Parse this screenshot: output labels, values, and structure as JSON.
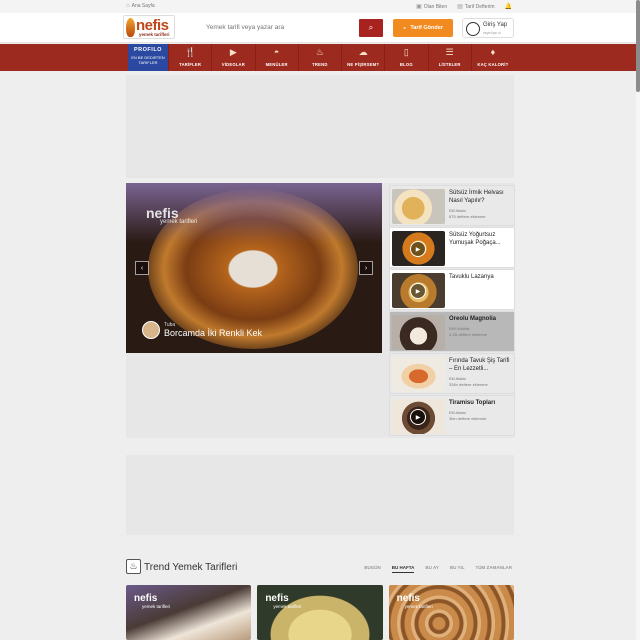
{
  "topbar": {
    "home": "Ana Sayfa",
    "olan_biten": "Olan Biten",
    "tarif_defterim": "Tarif Defterim"
  },
  "header": {
    "logo_word": "nefis",
    "logo_sub": "yemek tarifleri",
    "search_placeholder": "Yemek tarifi veya yazar ara",
    "send_recipe": "Tarif Gönder",
    "login_title": "Giriş Yap",
    "login_sub": "veya üye ol"
  },
  "nav": {
    "profilo_title": "PROFILO",
    "profilo_sub": "EN BE DEDIRTEN TARIFLER",
    "items": [
      {
        "label": "TARİFLER",
        "icon": "utensils-icon"
      },
      {
        "label": "VİDEOLAR",
        "icon": "video-icon"
      },
      {
        "label": "MENÜLER",
        "icon": "cloche-icon"
      },
      {
        "label": "TREND",
        "icon": "flame-icon"
      },
      {
        "label": "NE PİŞİRSEM?",
        "icon": "chef-hat-icon"
      },
      {
        "label": "BLOG",
        "icon": "book-icon"
      },
      {
        "label": "LİSTELER",
        "icon": "list-icon"
      },
      {
        "label": "KAÇ KALORİ?",
        "icon": "ice-cream-icon"
      }
    ]
  },
  "slider": {
    "watermark": "nefis",
    "watermark_sub": "yemek tarifleri",
    "author": "Tuba",
    "title": "Borcamda İki Renkli Kek"
  },
  "side_list": [
    {
      "title": "Sütsüz İrmik Helvası Nasıl Yapılır?",
      "author": "Elif Atalar",
      "meta": "875 deftere eklenme",
      "style": "grey"
    },
    {
      "title": "Sütsüz Yoğurtsuz Yumuşak Poğaça...",
      "author": "",
      "meta": "",
      "style": "white"
    },
    {
      "title": "Tavuklu Lazanya",
      "author": "",
      "meta": "",
      "style": "white"
    },
    {
      "title": "Oreolu Magnolia",
      "author": "Elif'f Mutfak",
      "meta": "3,1B deftere eklenme",
      "style": "dark"
    },
    {
      "title": "Fırında Tavuk Şiş Tarifi – En Lezzetli...",
      "author": "Elif Atalar",
      "meta": "336n deftere eklenme",
      "style": "grey"
    },
    {
      "title": "Tiramisu Topları",
      "author": "Elif Atalar",
      "meta": "3bin deftere eklenme",
      "style": "grey"
    }
  ],
  "trend": {
    "title": "Trend Yemek Tarifleri",
    "tabs": [
      "BUGÜN",
      "BU HAFTA",
      "BU AY",
      "BU YIL",
      "TÜM ZAMANLAR"
    ],
    "active_tab": "BU HAFTA",
    "card_watermark": "nefis",
    "card_watermark_sub": "yemek tarifleri"
  },
  "colors": {
    "brand_red": "#9d2a1f",
    "search_button": "#a8231f",
    "send_button": "#f28b1f",
    "profilo_blue": "#2b49a0"
  }
}
